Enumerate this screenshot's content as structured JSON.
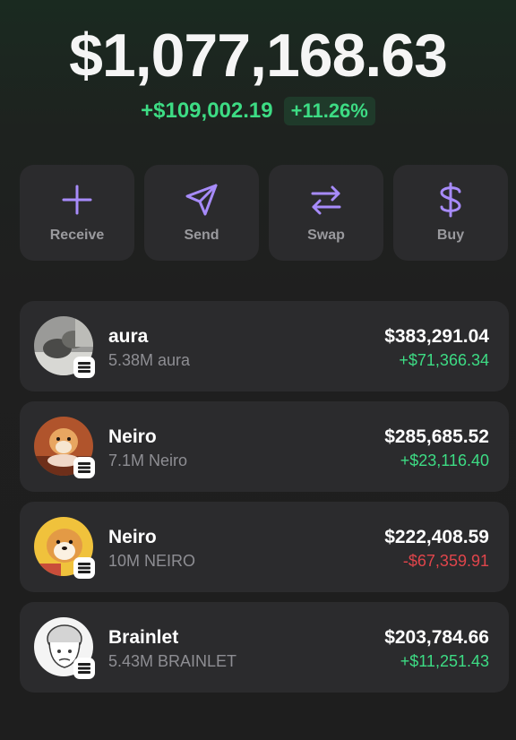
{
  "portfolio": {
    "balance": "$1,077,168.63",
    "change_amount": "+$109,002.19",
    "change_percent": "+11.26%"
  },
  "actions": [
    {
      "label": "Receive",
      "icon": "plus-icon"
    },
    {
      "label": "Send",
      "icon": "send-icon"
    },
    {
      "label": "Swap",
      "icon": "swap-icon"
    },
    {
      "label": "Buy",
      "icon": "dollar-icon"
    }
  ],
  "tokens": [
    {
      "name": "aura",
      "amount": "5.38M aura",
      "value": "$383,291.04",
      "pnl": "+$71,366.34",
      "pnl_direction": "up",
      "chain_icon": "solana-icon"
    },
    {
      "name": "Neiro",
      "amount": "7.1M Neiro",
      "value": "$285,685.52",
      "pnl": "+$23,116.40",
      "pnl_direction": "up",
      "chain_icon": "solana-icon"
    },
    {
      "name": "Neiro",
      "amount": "10M NEIRO",
      "value": "$222,408.59",
      "pnl": "-$67,359.91",
      "pnl_direction": "down",
      "chain_icon": "solana-icon"
    },
    {
      "name": "Brainlet",
      "amount": "5.43M BRAINLET",
      "value": "$203,784.66",
      "pnl": "+$11,251.43",
      "pnl_direction": "up",
      "chain_icon": "solana-icon"
    }
  ],
  "colors": {
    "accent": "#a78bfa",
    "positive": "#3ddc84",
    "negative": "#e0454b",
    "card": "#2b2b2d",
    "background": "#1e1e1e"
  }
}
